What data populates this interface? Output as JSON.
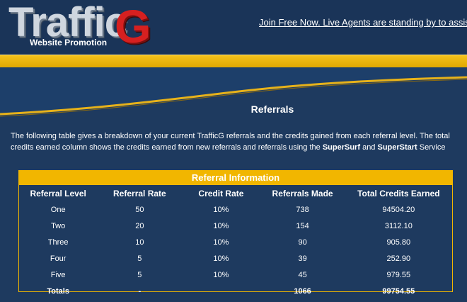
{
  "header": {
    "logo_main": "Traffic",
    "logo_g": "G",
    "logo_sub": "Website Promotion",
    "link": "Join Free Now. Live Agents are standing by to assist"
  },
  "colors": {
    "navy": "#1e3a5f",
    "gold": "#f1b600",
    "logo_red": "#d62020"
  },
  "page": {
    "title": "Referrals",
    "intro_part1": "The following table gives a breakdown of your current TrafficG referrals and the credits gained from each referral level. The total credits earned column shows the credits earned from new referrals and referrals using the ",
    "supersurf": "SuperSurf",
    "intro_and": " and ",
    "superstart": "SuperStart",
    "intro_end": " Service"
  },
  "table": {
    "caption": "Referral Information",
    "headers": [
      "Referral Level",
      "Referral Rate",
      "Credit Rate",
      "Referrals Made",
      "Total Credits Earned"
    ],
    "rows": [
      [
        "One",
        "50",
        "10%",
        "738",
        "94504.20"
      ],
      [
        "Two",
        "20",
        "10%",
        "154",
        "3112.10"
      ],
      [
        "Three",
        "10",
        "10%",
        "90",
        "905.80"
      ],
      [
        "Four",
        "5",
        "10%",
        "39",
        "252.90"
      ],
      [
        "Five",
        "5",
        "10%",
        "45",
        "979.55"
      ]
    ],
    "totals": [
      "Totals",
      "-",
      "",
      "1066",
      "99754.55"
    ]
  }
}
